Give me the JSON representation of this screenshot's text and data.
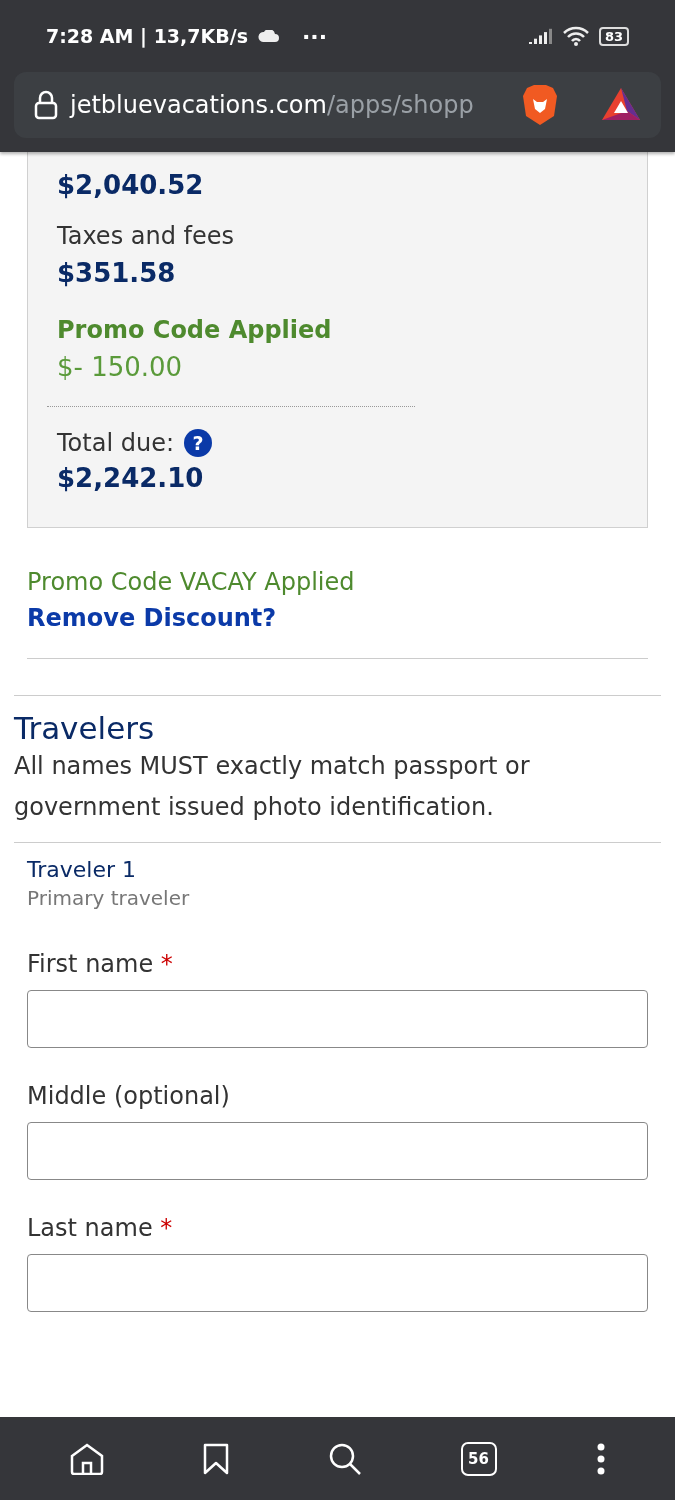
{
  "status_bar": {
    "time": "7:28 AM | 13,7KB/s",
    "more": "···",
    "battery": "83"
  },
  "address_bar": {
    "domain": "jetbluevacations.com",
    "path": "/apps/shopp"
  },
  "summary": {
    "items": [
      {
        "kind": "price",
        "value": "$2,040.52"
      },
      {
        "kind": "price",
        "label": "Taxes and fees",
        "value": "$351.58"
      },
      {
        "kind": "promo",
        "label": "Promo Code Applied",
        "value": "$- 150.00"
      }
    ],
    "total_label": "Total due:",
    "total_help": "?",
    "total": "$2,242.10"
  },
  "promo": {
    "message": "Promo Code VACAY Applied",
    "remove_link": "Remove Discount?"
  },
  "travelers": {
    "title": "Travelers",
    "note": "All names MUST exactly match passport or government issued photo identification.",
    "traveler_title": "Traveler 1",
    "traveler_subtitle": "Primary traveler",
    "fields": [
      {
        "label": "First name",
        "required": true
      },
      {
        "label": "Middle (optional)",
        "required": false
      },
      {
        "label": "Last name",
        "required": true
      }
    ],
    "required_mark": "*"
  },
  "bottom_nav": {
    "tabs_count": "56"
  }
}
